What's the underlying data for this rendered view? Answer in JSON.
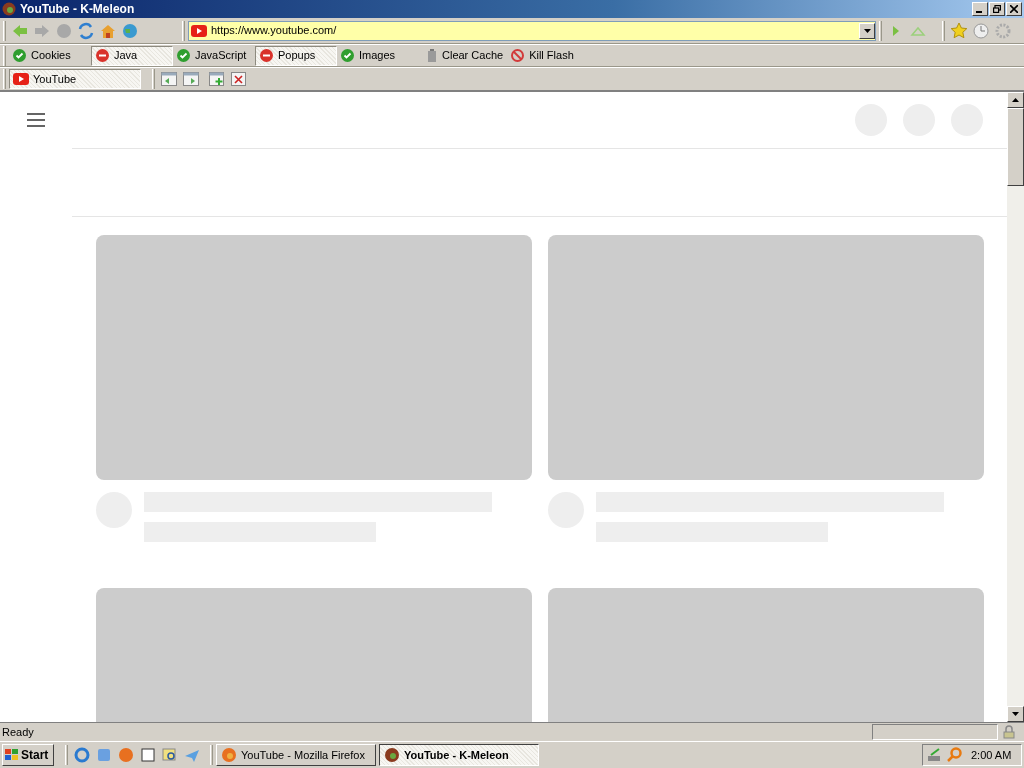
{
  "window": {
    "title": "YouTube - K-Meleon"
  },
  "address_bar": {
    "value": "https://www.youtube.com/"
  },
  "toggles": [
    {
      "label": "Cookies",
      "enabled": true
    },
    {
      "label": "Java",
      "enabled": false
    },
    {
      "label": "JavaScript",
      "enabled": true
    },
    {
      "label": "Popups",
      "enabled": false
    },
    {
      "label": "Images",
      "enabled": true
    }
  ],
  "actions": [
    {
      "label": "Clear Cache",
      "kind": "clear"
    },
    {
      "label": "Kill Flash",
      "kind": "kill"
    }
  ],
  "tabs": [
    {
      "label": "YouTube",
      "selected": true
    }
  ],
  "page": {
    "cards": [
      {
        "kind": "skeleton"
      },
      {
        "kind": "skeleton"
      },
      {
        "kind": "thumbnail"
      },
      {
        "kind": "thumbnail"
      }
    ]
  },
  "status_bar": {
    "text": "Ready"
  },
  "taskbar": {
    "start": "Start",
    "tasks": [
      {
        "label": "YouTube - Mozilla Firefox",
        "selected": false
      },
      {
        "label": "YouTube - K-Meleon",
        "selected": true
      }
    ],
    "clock": "2:00 AM"
  }
}
